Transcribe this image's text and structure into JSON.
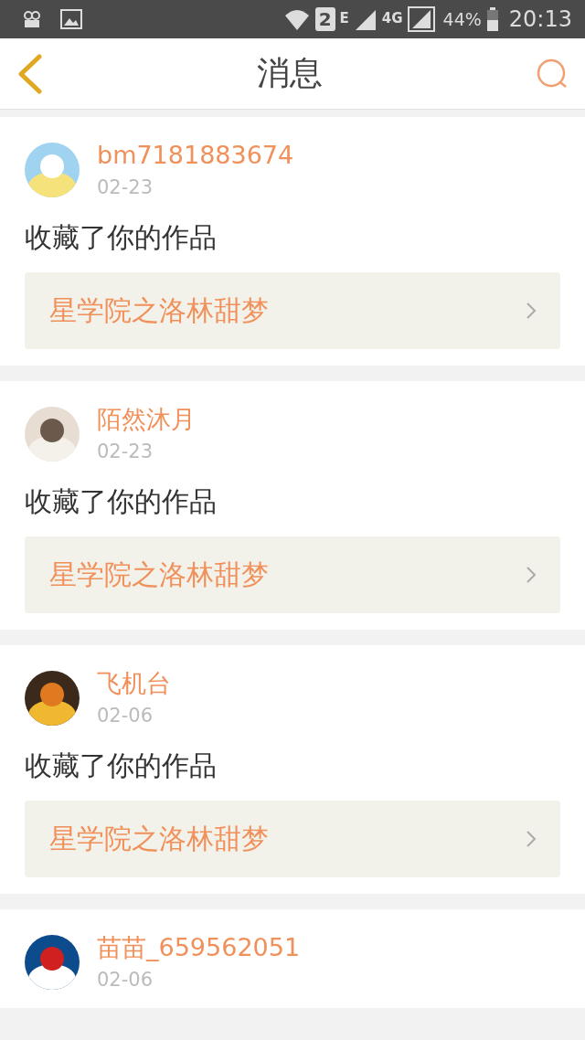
{
  "status_bar": {
    "sim_badge": "2",
    "network_e": "E",
    "network_4g": "4G",
    "battery": "44%",
    "time": "20:13"
  },
  "header": {
    "title": "消息"
  },
  "messages": [
    {
      "user": "bm7181883674",
      "date": "02-23",
      "action": "收藏了你的作品",
      "work_title": "星学院之洛林甜梦"
    },
    {
      "user": "陌然沐月",
      "date": "02-23",
      "action": "收藏了你的作品",
      "work_title": "星学院之洛林甜梦"
    },
    {
      "user": "飞机台",
      "date": "02-06",
      "action": "收藏了你的作品",
      "work_title": "星学院之洛林甜梦"
    },
    {
      "user": "苗苗_659562051",
      "date": "02-06"
    }
  ]
}
